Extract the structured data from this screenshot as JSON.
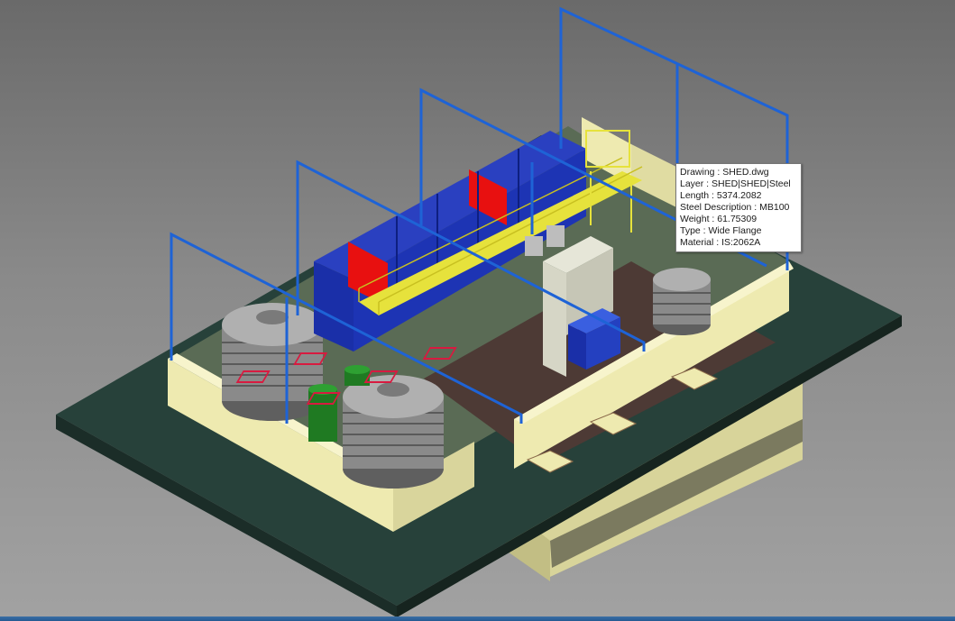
{
  "viewport": {
    "background_top": "#6a6a6a",
    "background_bottom": "#a2a2a2"
  },
  "colors": {
    "base_slab": "#27413a",
    "wall_cream": "#eeeab0",
    "floor_dark": "#4d3a35",
    "steel_blue": "#1e63d6",
    "tank_blue": "#1a2fa8",
    "cone_red": "#e81010",
    "walkway_yellow": "#e6e23c",
    "vessel_green": "#1f7a22"
  },
  "tooltip": {
    "drawing": "Drawing : SHED.dwg",
    "layer": "Layer : SHED|SHED|Steel",
    "length": "Length : 5374.2082",
    "steel_description": "Steel Description : MB100",
    "weight": "Weight : 61.75309",
    "type": "Type : Wide Flange",
    "material": "Material : IS:2062A"
  }
}
